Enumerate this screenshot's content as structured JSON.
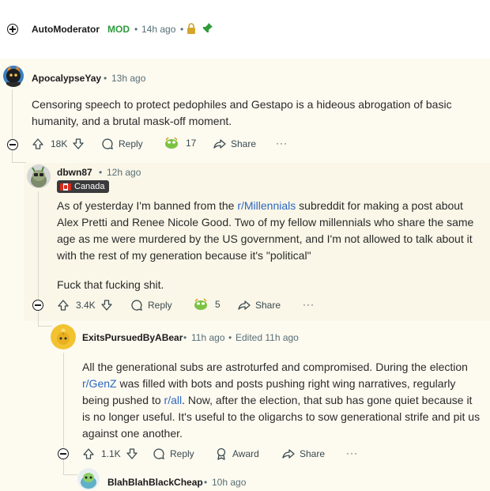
{
  "colors": {
    "mod": "#2e9b3c",
    "link": "#2b68c4",
    "highlight": "#fdfaf0"
  },
  "automod": {
    "user": "AutoModerator",
    "mod_badge": "MOD",
    "sep": "•",
    "time": "14h ago"
  },
  "comments": [
    {
      "user": "ApocalypseYay",
      "sep": "•",
      "time": "13h ago",
      "lines": [
        "Censoring speech to protect pedophiles and Gestapo is a hideous abrogation of basic",
        "humanity, and a brutal mask-off moment."
      ],
      "score": "18K",
      "reply": "Reply",
      "award_count": "17",
      "share": "Share",
      "more": "···"
    },
    {
      "user": "dbwn87",
      "sep": "•",
      "time": "12h ago",
      "flair": "Canada",
      "lines": [
        "As of yesterday I'm banned from the ",
        "r/Millennials",
        " subreddit for making a post about",
        "Alex Pretti and Renee Nicole Good. Two of my fellow millennials who share the same",
        "age as me were murdered by the US government, and I'm not allowed to talk about it",
        "with the rest of my generation because it's \"political\""
      ],
      "line2": "Fuck that fucking shit.",
      "score": "3.4K",
      "reply": "Reply",
      "award_count": "5",
      "share": "Share",
      "more": "···"
    },
    {
      "user": "ExitsPursuedByABear",
      "sep": "•",
      "time": "11h ago",
      "edited": "Edited 11h ago",
      "l1": "All the generational subs are astroturfed and compromised. During the election",
      "l2a": "r/GenZ",
      "l2b": " was filled with bots and posts pushing right wing narratives, regularly",
      "l3a": "being pushed to ",
      "l3b": "r/all",
      "l3c": ". Now, after the election, that sub has gone quiet because it",
      "l4": "is no longer useful. It's useful to the oligarchs to sow generational strife and pit us",
      "l5": "against one another.",
      "score": "1.1K",
      "reply": "Reply",
      "award": "Award",
      "share": "Share",
      "more": "···"
    },
    {
      "user": "BlahBlahBlackCheap",
      "sep": "•",
      "time": "10h ago"
    }
  ]
}
